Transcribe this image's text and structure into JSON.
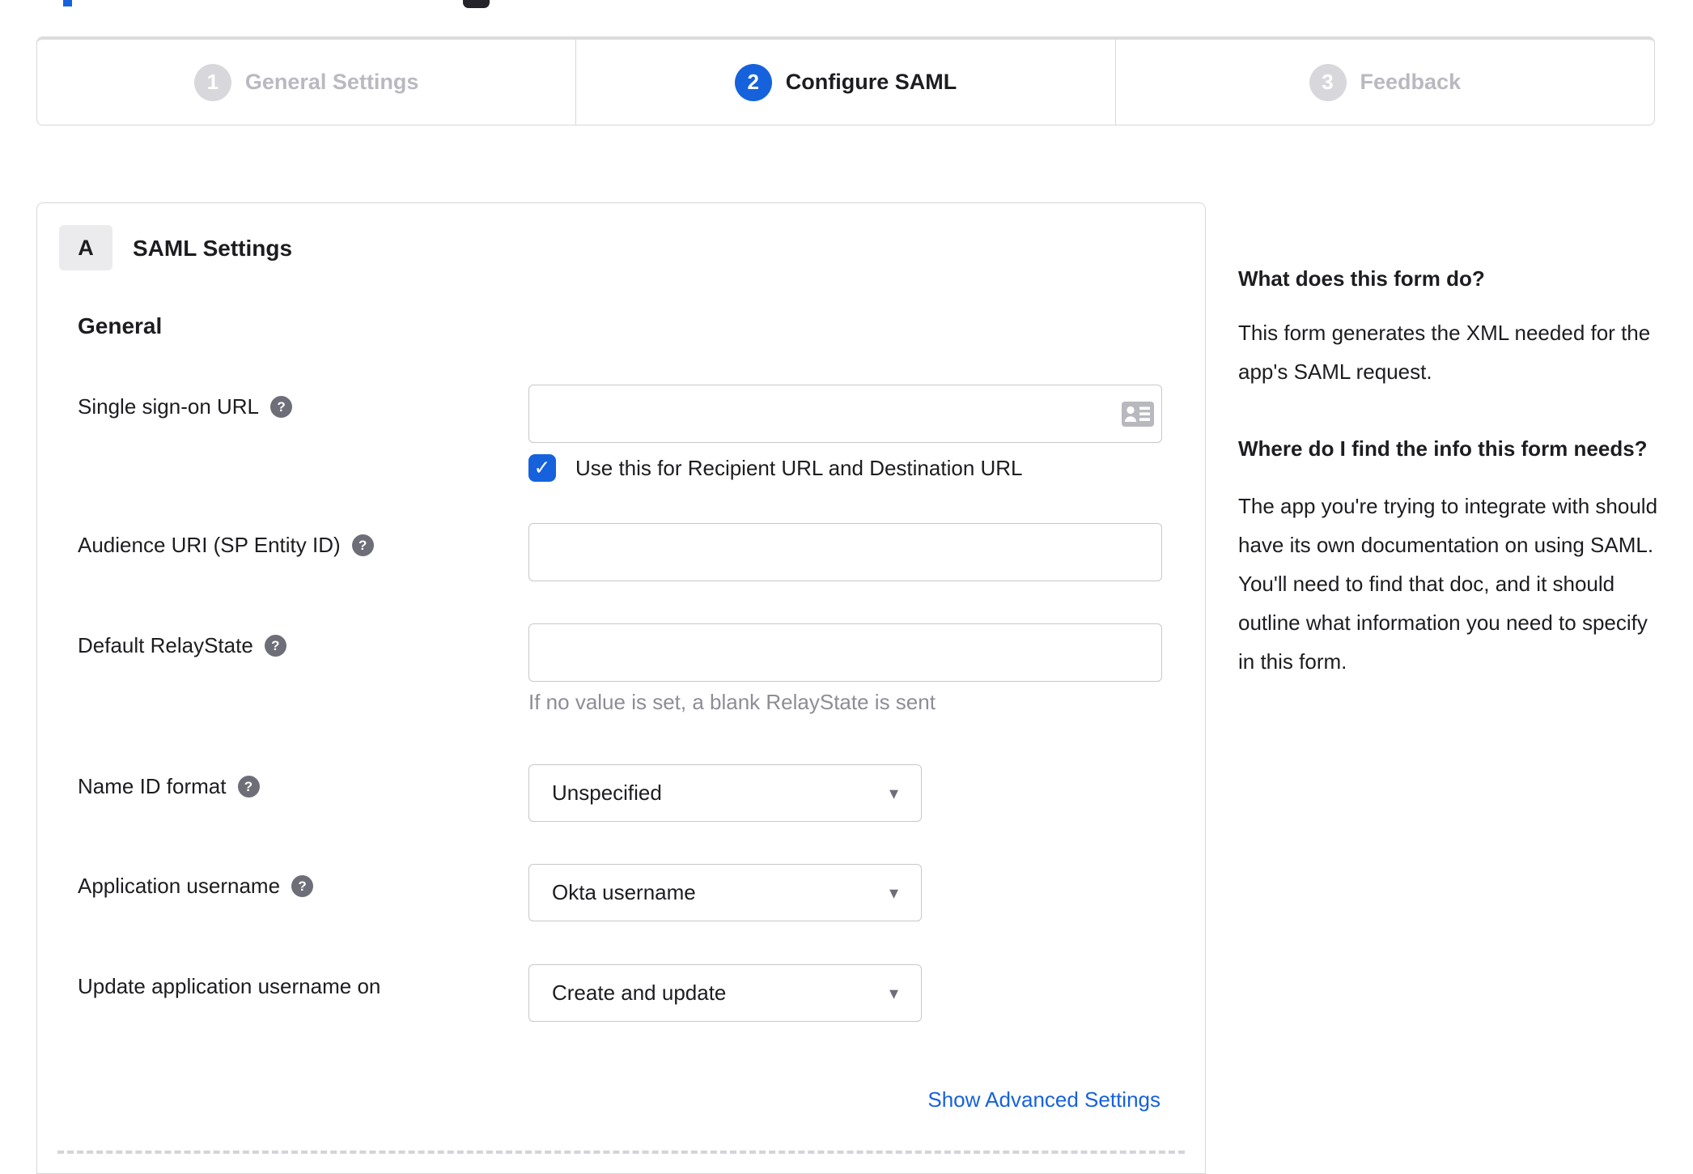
{
  "colors": {
    "accent_blue": "#1662dd",
    "inactive_gray": "#b9b9c0",
    "border_gray": "#d8d8dc"
  },
  "icons": {
    "help": "?",
    "check": "✓",
    "caret": "▾",
    "input_trailing": "contact-card-icon"
  },
  "stepper": {
    "steps": [
      {
        "number": "1",
        "label": "General Settings",
        "state": "inactive"
      },
      {
        "number": "2",
        "label": "Configure SAML",
        "state": "active"
      },
      {
        "number": "3",
        "label": "Feedback",
        "state": "inactive"
      }
    ]
  },
  "form_card": {
    "section_badge": "A",
    "section_title": "SAML Settings",
    "group_heading": "General",
    "fields": [
      {
        "label": "Single sign-on URL",
        "has_help": true,
        "type": "text",
        "value": "",
        "trailing_icon": "contact-card-icon",
        "checkbox": {
          "checked": true,
          "label": "Use this for Recipient URL and Destination URL"
        }
      },
      {
        "label": "Audience URI (SP Entity ID)",
        "has_help": true,
        "type": "text",
        "value": ""
      },
      {
        "label": "Default RelayState",
        "has_help": true,
        "type": "text",
        "value": "",
        "hint": "If no value is set, a blank RelayState is sent"
      },
      {
        "label": "Name ID format",
        "has_help": true,
        "type": "select",
        "value": "Unspecified"
      },
      {
        "label": "Application username",
        "has_help": true,
        "type": "select",
        "value": "Okta username"
      },
      {
        "label": "Update application username on",
        "has_help": false,
        "type": "select",
        "value": "Create and update"
      }
    ],
    "advanced_link": "Show Advanced Settings"
  },
  "sidebar": {
    "heading_1": "What does this form do?",
    "paragraph_1": "This form generates the XML needed for the app's SAML request.",
    "heading_2": "Where do I find the info this form needs?",
    "paragraph_2": "The app you're trying to integrate with should have its own documentation on using SAML. You'll need to find that doc, and it should outline what information you need to specify in this form."
  }
}
